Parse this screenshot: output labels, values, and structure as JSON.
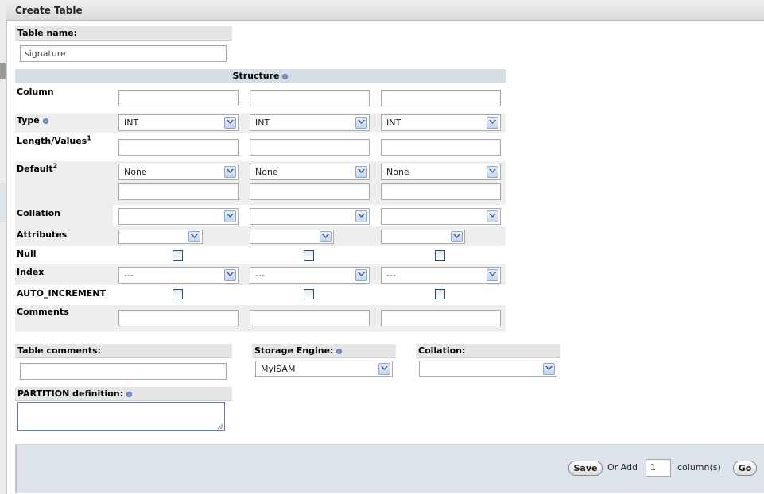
{
  "window": {
    "title": "Create Table"
  },
  "table_name": {
    "label": "Table name:",
    "value": "signature"
  },
  "structure": {
    "header": "Structure",
    "labels": {
      "column": "Column",
      "type": "Type",
      "length_values": "Length/Values",
      "length_sup": "1",
      "default": "Default",
      "default_sup": "2",
      "collation": "Collation",
      "attributes": "Attributes",
      "null": "Null",
      "index": "Index",
      "auto_increment": "AUTO_INCREMENT",
      "comments": "Comments"
    },
    "columns": [
      {
        "name": "",
        "type": "INT",
        "length": "",
        "default": "None",
        "default_value": "",
        "collation": "",
        "attributes": "",
        "null": false,
        "index": "---",
        "auto_increment": false,
        "comments": ""
      },
      {
        "name": "",
        "type": "INT",
        "length": "",
        "default": "None",
        "default_value": "",
        "collation": "",
        "attributes": "",
        "null": false,
        "index": "---",
        "auto_increment": false,
        "comments": ""
      },
      {
        "name": "",
        "type": "INT",
        "length": "",
        "default": "None",
        "default_value": "",
        "collation": "",
        "attributes": "",
        "null": false,
        "index": "---",
        "auto_increment": false,
        "comments": ""
      }
    ]
  },
  "table_comments": {
    "label": "Table comments:",
    "value": ""
  },
  "storage_engine": {
    "label": "Storage Engine:",
    "value": "MyISAM"
  },
  "collation": {
    "label": "Collation:",
    "value": ""
  },
  "partition": {
    "label": "PARTITION definition:",
    "value": ""
  },
  "footer": {
    "save": "Save",
    "or_add": "Or Add",
    "add_count": "1",
    "columns_suffix": "column(s)",
    "go": "Go"
  },
  "icons": {
    "help": "help-icon",
    "dropdown": "chevron-down-icon",
    "resize": "resize-grip-icon"
  },
  "colors": {
    "structure_header": "#d5dde6",
    "footer": "#dce3ea",
    "checkbox_border": "#1c5180"
  }
}
